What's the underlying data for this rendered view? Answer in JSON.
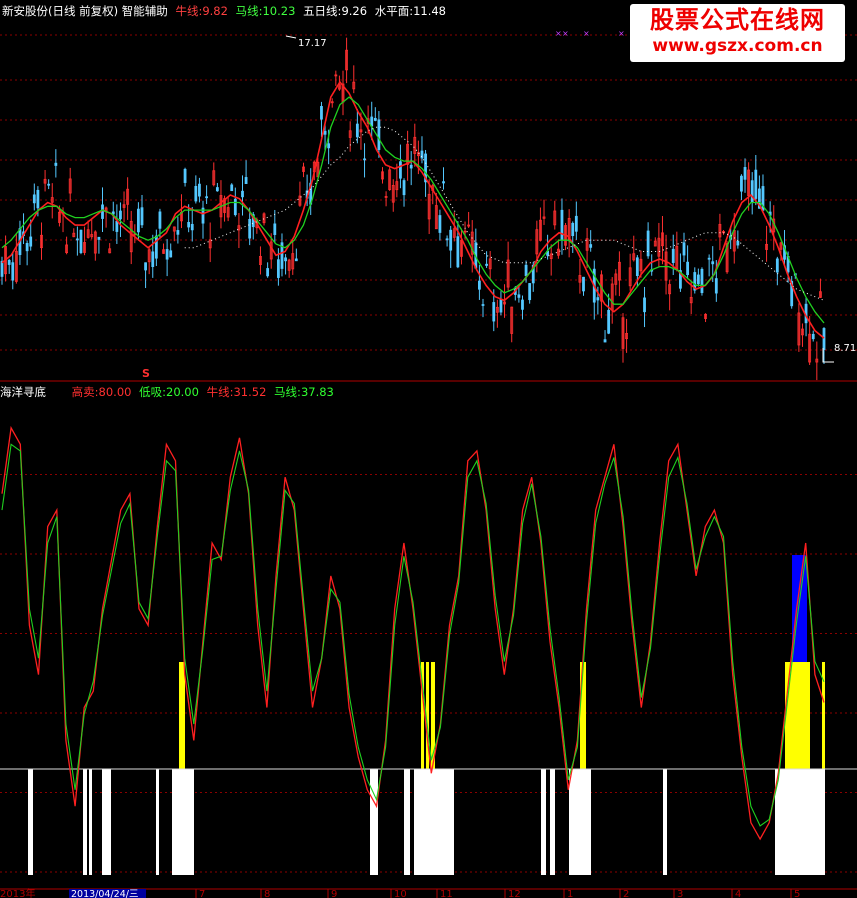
{
  "top_header": {
    "title": "新安股份(日线 前复权) 智能辅助",
    "items": [
      {
        "label": "牛线:",
        "value": "9.82",
        "color": "#ff4040"
      },
      {
        "label": "马线:",
        "value": "10.23",
        "color": "#40ff40"
      },
      {
        "label": "五日线:",
        "value": "9.26",
        "color": "#ffffff"
      },
      {
        "label": "水平面:",
        "value": "11.48",
        "color": "#ffffff"
      }
    ]
  },
  "watermark": {
    "line1": "股票公式在线网",
    "line2": "www.gszx.com.cn"
  },
  "bottom_header": {
    "title": "海洋寻底",
    "items": [
      {
        "label": "高卖:",
        "value": "80.00",
        "color": "#ff3030"
      },
      {
        "label": "低吸:",
        "value": "20.00",
        "color": "#30ff30"
      },
      {
        "label": "牛线:",
        "value": "31.52",
        "color": "#ff3030"
      },
      {
        "label": "马线:",
        "value": "37.83",
        "color": "#30ff30"
      }
    ]
  },
  "annotations": {
    "high_price": "17.17",
    "low_price": "8.71",
    "signal": "S"
  },
  "x_axis": {
    "start_label": "2013年",
    "cursor_label": "2013/04/24/三",
    "months": [
      "7",
      "8",
      "9",
      "10",
      "11",
      "12",
      "1",
      "2",
      "3",
      "4",
      "5"
    ]
  },
  "colors": {
    "bull": "#ff2020",
    "horse": "#20d020",
    "up_candle": "#ff3030",
    "down_candle": "#54c8ff",
    "grid": "#8b0000",
    "yellow": "#ffff00",
    "blue": "#0000ff"
  },
  "chart_data": [
    {
      "type": "line",
      "title": "新安股份(日线 前复权) 智能辅助",
      "ylim": [
        8.3,
        17.7
      ],
      "series": [
        {
          "name": "牛线",
          "y": [
            11.2,
            11.4,
            11.8,
            12.2,
            12.6,
            12.8,
            12.7,
            12.4,
            12.2,
            12.2,
            12.4,
            12.6,
            12.5,
            12.2,
            12.0,
            11.8,
            11.6,
            11.8,
            12.0,
            12.5,
            12.7,
            12.6,
            12.5,
            12.6,
            12.8,
            13.0,
            12.9,
            12.6,
            12.2,
            11.8,
            11.4,
            11.5,
            11.9,
            12.6,
            13.4,
            14.5,
            15.6,
            16.0,
            15.7,
            15.2,
            14.8,
            14.2,
            13.8,
            13.7,
            13.8,
            13.9,
            13.6,
            13.2,
            12.8,
            12.4,
            12.0,
            11.5,
            11.0,
            10.6,
            10.3,
            10.2,
            10.4,
            10.7,
            11.0,
            11.5,
            11.8,
            12.0,
            11.9,
            11.5,
            11.0,
            10.5,
            10.1,
            9.9,
            10.1,
            10.5,
            10.9,
            11.2,
            11.3,
            11.2,
            11.0,
            10.7,
            10.5,
            10.6,
            10.9,
            11.6,
            12.3,
            12.8,
            13.0,
            12.7,
            12.2,
            11.6,
            10.9,
            10.3,
            9.8,
            9.4,
            9.2
          ]
        },
        {
          "name": "马线",
          "y": [
            11.6,
            11.8,
            12.1,
            12.4,
            12.6,
            12.7,
            12.7,
            12.5,
            12.4,
            12.4,
            12.5,
            12.6,
            12.5,
            12.3,
            12.1,
            11.9,
            11.8,
            11.9,
            12.1,
            12.4,
            12.6,
            12.6,
            12.6,
            12.6,
            12.7,
            12.8,
            12.8,
            12.6,
            12.3,
            12.0,
            11.7,
            11.6,
            11.8,
            12.2,
            12.9,
            13.8,
            14.8,
            15.4,
            15.6,
            15.4,
            15.0,
            14.6,
            14.2,
            14.0,
            13.9,
            13.9,
            13.7,
            13.4,
            13.0,
            12.6,
            12.2,
            11.8,
            11.3,
            10.9,
            10.6,
            10.4,
            10.5,
            10.7,
            11.0,
            11.3,
            11.6,
            11.8,
            11.8,
            11.6,
            11.2,
            10.8,
            10.4,
            10.1,
            10.1,
            10.4,
            10.7,
            11.0,
            11.1,
            11.1,
            11.0,
            10.8,
            10.6,
            10.6,
            10.9,
            11.4,
            12.0,
            12.5,
            12.8,
            12.8,
            12.5,
            12.0,
            11.4,
            10.8,
            10.3,
            9.9,
            9.6
          ]
        },
        {
          "name": "五日线",
          "y": [
            null,
            null,
            null,
            null,
            null,
            null,
            null,
            null,
            null,
            null,
            null,
            null,
            null,
            null,
            null,
            null,
            null,
            null,
            null,
            null,
            11.6,
            11.6,
            11.7,
            11.8,
            11.9,
            12.0,
            12.1,
            12.2,
            12.3,
            12.4,
            12.5,
            12.6,
            12.8,
            13.0,
            13.2,
            13.5,
            13.8,
            14.0,
            14.3,
            14.5,
            14.7,
            14.8,
            14.8,
            14.7,
            14.5,
            14.3,
            14.0,
            13.6,
            13.2,
            12.8,
            12.4,
            12.0,
            11.7,
            11.4,
            11.3,
            11.2,
            11.2,
            11.2,
            11.2,
            11.3,
            11.4,
            11.5,
            11.6,
            11.7,
            11.8,
            11.8,
            11.8,
            11.8,
            11.7,
            11.6,
            11.5,
            11.5,
            11.5,
            11.6,
            11.7,
            11.8,
            11.9,
            12.0,
            12.0,
            12.0,
            11.9,
            11.7,
            11.5,
            11.3,
            11.1,
            10.9,
            10.7,
            10.5,
            10.4,
            10.3,
            10.2
          ]
        }
      ]
    },
    {
      "type": "line",
      "title": "海洋寻底",
      "ylim": [
        -20,
        125
      ],
      "series": [
        {
          "name": "牛线",
          "y": [
            95,
            115,
            110,
            55,
            40,
            85,
            90,
            20,
            0,
            30,
            35,
            60,
            75,
            90,
            95,
            60,
            55,
            85,
            110,
            105,
            40,
            20,
            50,
            80,
            75,
            100,
            112,
            95,
            55,
            30,
            70,
            100,
            90,
            60,
            30,
            45,
            70,
            60,
            30,
            15,
            5,
            0,
            20,
            60,
            80,
            60,
            35,
            10,
            25,
            55,
            70,
            105,
            108,
            90,
            60,
            40,
            60,
            90,
            100,
            80,
            50,
            30,
            5,
            20,
            60,
            90,
            100,
            110,
            85,
            55,
            30,
            50,
            80,
            105,
            110,
            90,
            70,
            85,
            90,
            80,
            40,
            15,
            -5,
            -10,
            -5,
            10,
            35,
            60,
            80,
            40,
            31.52
          ]
        },
        {
          "name": "马线",
          "y": [
            90,
            110,
            108,
            60,
            45,
            80,
            88,
            25,
            5,
            28,
            38,
            58,
            72,
            86,
            92,
            62,
            57,
            82,
            105,
            102,
            45,
            25,
            48,
            75,
            76,
            96,
            108,
            96,
            60,
            35,
            66,
            96,
            92,
            63,
            35,
            45,
            66,
            62,
            34,
            18,
            8,
            2,
            18,
            55,
            76,
            62,
            38,
            14,
            24,
            52,
            68,
            100,
            105,
            92,
            64,
            44,
            58,
            86,
            98,
            82,
            54,
            33,
            8,
            18,
            56,
            86,
            98,
            106,
            88,
            58,
            33,
            48,
            76,
            100,
            106,
            92,
            72,
            82,
            88,
            82,
            44,
            18,
            0,
            -6,
            -4,
            8,
            32,
            56,
            76,
            44,
            37.83
          ]
        }
      ],
      "levels": [
        {
          "name": "高卖",
          "value": 80.0
        },
        {
          "name": "低吸",
          "value": 20.0
        }
      ]
    }
  ]
}
